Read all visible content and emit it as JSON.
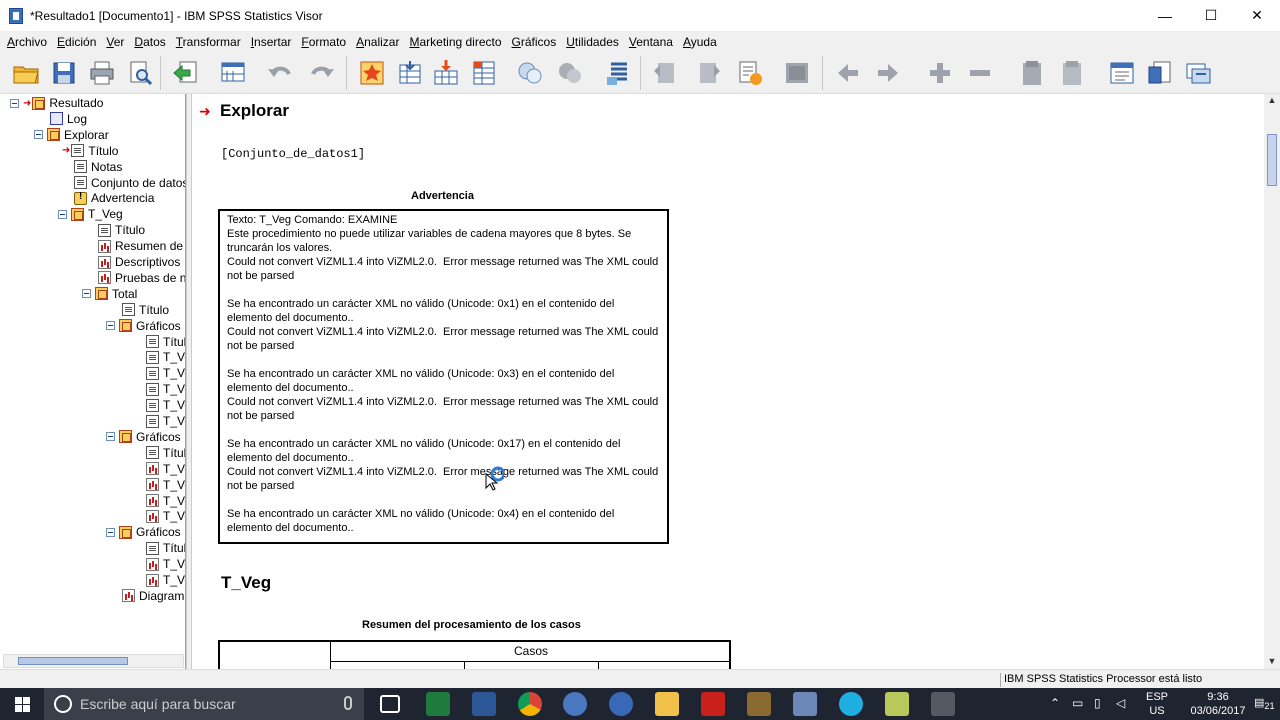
{
  "window": {
    "title": "*Resultado1 [Documento1] - IBM SPSS Statistics Visor",
    "minimize": "—",
    "maximize": "☐",
    "close": "✕"
  },
  "menu": [
    "Archivo",
    "Edición",
    "Ver",
    "Datos",
    "Transformar",
    "Insertar",
    "Formato",
    "Analizar",
    "Marketing directo",
    "Gráficos",
    "Utilidades",
    "Ventana",
    "Ayuda"
  ],
  "tree": [
    {
      "label": "Resultado",
      "icon": "book",
      "expander": true,
      "arrow": true
    },
    {
      "label": "Log",
      "icon": "log"
    },
    {
      "label": "Explorar",
      "icon": "book",
      "expander": true
    },
    {
      "label": "Título",
      "icon": "page",
      "arrow": true
    },
    {
      "label": "Notas",
      "icon": "page"
    },
    {
      "label": "Conjunto de datos",
      "icon": "page"
    },
    {
      "label": "Advertencia",
      "icon": "warn"
    },
    {
      "label": "T_Veg",
      "icon": "book",
      "expander": true
    },
    {
      "label": "Título",
      "icon": "page"
    },
    {
      "label": "Resumen de",
      "icon": "chart"
    },
    {
      "label": "Descriptivos",
      "icon": "chart"
    },
    {
      "label": "Pruebas de n",
      "icon": "chart"
    },
    {
      "label": "Total",
      "icon": "book",
      "expander": true
    },
    {
      "label": "Título",
      "icon": "page"
    },
    {
      "label": "Gráficos",
      "icon": "book",
      "expander": true
    },
    {
      "label": "Títul",
      "icon": "page"
    },
    {
      "label": "T_Ve",
      "icon": "page"
    },
    {
      "label": "T_Ve",
      "icon": "page"
    },
    {
      "label": "T_Ve",
      "icon": "page"
    },
    {
      "label": "T_Ve",
      "icon": "page"
    },
    {
      "label": "T_Ve",
      "icon": "page"
    },
    {
      "label": "Gráficos",
      "icon": "book",
      "expander": true
    },
    {
      "label": "Títul",
      "icon": "page"
    },
    {
      "label": "T_Ve",
      "icon": "chart"
    },
    {
      "label": "T_Ve",
      "icon": "chart"
    },
    {
      "label": "T_Ve",
      "icon": "chart"
    },
    {
      "label": "T_Ve",
      "icon": "chart"
    },
    {
      "label": "Gráficos",
      "icon": "book",
      "expander": true
    },
    {
      "label": "Títul",
      "icon": "page"
    },
    {
      "label": "T_Ve",
      "icon": "chart"
    },
    {
      "label": "T_Ve",
      "icon": "chart"
    },
    {
      "label": "Diagram",
      "icon": "chart"
    }
  ],
  "content": {
    "section_title": "Explorar",
    "dataset": "[Conjunto_de_datos1]",
    "warning_caption": "Advertencia",
    "warning_lines": [
      "Texto: T_Veg Comando: EXAMINE",
      "Este procedimiento no puede utilizar variables de cadena mayores que 8 bytes. Se truncarán los valores.",
      "Could not convert ViZML1.4 into ViZML2.0.  Error message returned was The XML could not be parsed",
      "",
      "Se ha encontrado un carácter XML no válido (Unicode: 0x1) en el contenido del elemento del documento..",
      "Could not convert ViZML1.4 into ViZML2.0.  Error message returned was The XML could not be parsed",
      "",
      "Se ha encontrado un carácter XML no válido (Unicode: 0x3) en el contenido del elemento del documento..",
      "Could not convert ViZML1.4 into ViZML2.0.  Error message returned was The XML could not be parsed",
      "",
      "Se ha encontrado un carácter XML no válido (Unicode: 0x17) en el contenido del elemento del documento..",
      "Could not convert ViZML1.4 into ViZML2.0.  Error message returned was The XML could not be parsed",
      "",
      "Se ha encontrado un carácter XML no válido (Unicode: 0x4) en el contenido del elemento del documento.."
    ],
    "subsection_title": "T_Veg",
    "case_caption": "Resumen del procesamiento de los casos",
    "case_header": "Casos"
  },
  "status": "IBM SPSS Statistics Processor está listo",
  "taskbar": {
    "search_placeholder": "Escribe aquí para buscar",
    "lang_top": "ESP",
    "lang_bottom": "US",
    "time": "9:36",
    "date": "03/06/2017",
    "notifications": "21"
  },
  "colors": {
    "accent_red": "#e00000",
    "taskbar": "#1e2430",
    "chrome": "#f0f0f0"
  }
}
